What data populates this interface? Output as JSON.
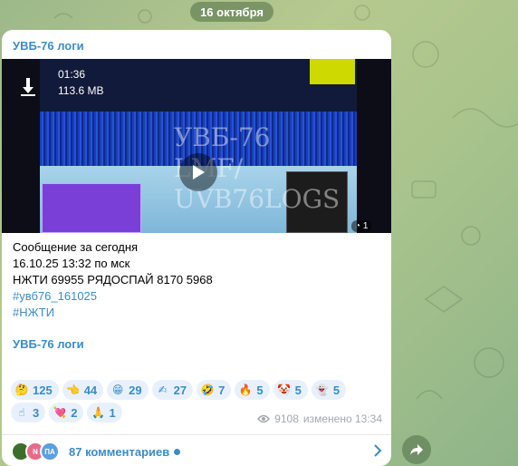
{
  "date_separator": "16 октября",
  "post": {
    "channel_name": "УВБ-76 логи",
    "video": {
      "duration": "01:36",
      "file_size": "113.6 MB",
      "watermark_lines": [
        "УВБ-76",
        "LMF/",
        "UVB76LOGS"
      ],
      "corner_count": "1"
    },
    "text_lines": [
      "Сообщение за сегодня",
      "16.10.25 13:32 по мск",
      "НЖТИ 69955 РЯДОСПАЙ 8170 5968"
    ],
    "hashtags": [
      "#увб76_161025",
      "#НЖТИ"
    ],
    "footer_link": "УВБ-76 логи",
    "reactions_row1": [
      {
        "emoji": "thinking",
        "count": "125"
      },
      {
        "emoji": "pointing",
        "count": "44"
      },
      {
        "emoji": "grin",
        "count": "29"
      },
      {
        "emoji": "writing",
        "count": "27"
      },
      {
        "emoji": "rofl",
        "count": "7"
      },
      {
        "emoji": "fire",
        "count": "5"
      },
      {
        "emoji": "clown",
        "count": "5"
      },
      {
        "emoji": "ghost",
        "count": "5"
      }
    ],
    "reactions_row2": [
      {
        "emoji": "point-up",
        "count": "3"
      },
      {
        "emoji": "heart-arrow",
        "count": "2"
      },
      {
        "emoji": "pray",
        "count": "1"
      }
    ],
    "views": "9108",
    "edited_label": "изменено 13:34",
    "comments": {
      "label": "87 комментариев",
      "avatars": [
        "",
        "N",
        "ПА"
      ]
    }
  },
  "colors": {
    "accent": "#3a8cc6",
    "reaction_bg": "#e8f1fb"
  }
}
